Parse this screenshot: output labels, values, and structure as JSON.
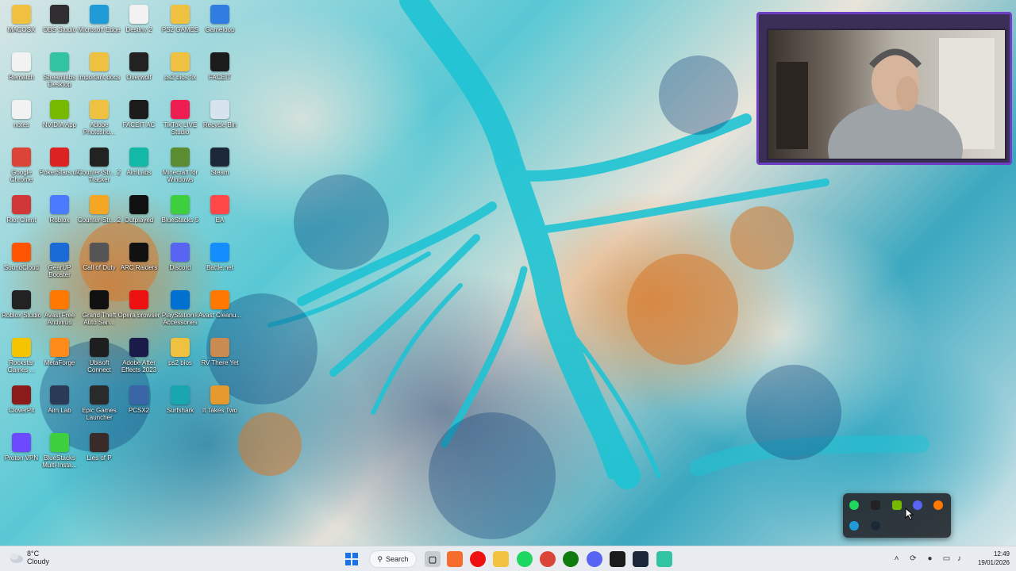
{
  "desktop_icons": [
    {
      "label": "MACOSX",
      "color": "#f0c040"
    },
    {
      "label": "OBS Studio",
      "color": "#302e31"
    },
    {
      "label": "Microsoft Edge",
      "color": "#1f9cd8"
    },
    {
      "label": "Destiny 2",
      "color": "#f2f2f2"
    },
    {
      "label": "PS2 GAMES",
      "color": "#f0c040"
    },
    {
      "label": "Gameloop",
      "color": "#2f7de1"
    },
    {
      "label": "Rematch",
      "color": "#f2f2f2"
    },
    {
      "label": "Streamlabs Desktop",
      "color": "#31c3a2"
    },
    {
      "label": "important docs",
      "color": "#f0c040"
    },
    {
      "label": "Overwolf",
      "color": "#222222"
    },
    {
      "label": "ps2 bios fix",
      "color": "#f0c040"
    },
    {
      "label": "FACEIT",
      "color": "#1b1b1b"
    },
    {
      "label": "notes",
      "color": "#f2f2f2"
    },
    {
      "label": "NVIDIA App",
      "color": "#76b900"
    },
    {
      "label": "Adobe Photosho...",
      "color": "#f0c040"
    },
    {
      "label": "FACEIT AC",
      "color": "#1b1b1b"
    },
    {
      "label": "TikTok LIVE Studio",
      "color": "#ee1d52"
    },
    {
      "label": "Recycle Bin",
      "color": "#d7e3ef"
    },
    {
      "label": "Google Chrome",
      "color": "#db4437"
    },
    {
      "label": "PokerStars.uk",
      "color": "#d22"
    },
    {
      "label": "Counter-Str... 2 Tracker",
      "color": "#222"
    },
    {
      "label": "AimLabs",
      "color": "#14b8a6"
    },
    {
      "label": "Minecraft for Windows",
      "color": "#5b8c32"
    },
    {
      "label": "Steam",
      "color": "#1b2838"
    },
    {
      "label": "Riot Client",
      "color": "#d13639"
    },
    {
      "label": "Roblox",
      "color": "#4a7bff"
    },
    {
      "label": "Counter-Str... 2",
      "color": "#f5a623"
    },
    {
      "label": "Outplayed",
      "color": "#111"
    },
    {
      "label": "BlueStacks 5",
      "color": "#3ecf3e"
    },
    {
      "label": "EA",
      "color": "#ff4747"
    },
    {
      "label": "SoundCloud",
      "color": "#ff5500"
    },
    {
      "label": "GearUP Booster",
      "color": "#1a6bd6"
    },
    {
      "label": "Call of Duty",
      "color": "#555"
    },
    {
      "label": "ARC Raiders",
      "color": "#111"
    },
    {
      "label": "Discord",
      "color": "#5865f2"
    },
    {
      "label": "Battle.net",
      "color": "#148eff"
    },
    {
      "label": "Roblox Studio",
      "color": "#222"
    },
    {
      "label": "Avast Free Antivirus",
      "color": "#ff7800"
    },
    {
      "label": "Grand Theft Auto San...",
      "color": "#111"
    },
    {
      "label": "Opera browser",
      "color": "#e11"
    },
    {
      "label": "PlayStation® Accessories",
      "color": "#0070d1"
    },
    {
      "label": "Avast Cleanu...",
      "color": "#ff7800"
    },
    {
      "label": "Rockstar Games ...",
      "color": "#f5c400"
    },
    {
      "label": "MetaForge",
      "color": "#ff8c1a"
    },
    {
      "label": "Ubisoft Connect",
      "color": "#1e1e1e"
    },
    {
      "label": "Adobe After Effects 2023",
      "color": "#1b1b4b"
    },
    {
      "label": "ps2 bios",
      "color": "#f0c040"
    },
    {
      "label": "RV There Yet",
      "color": "#c98b52"
    },
    {
      "label": "CloverPit",
      "color": "#8b1a1a"
    },
    {
      "label": "Aim Lab",
      "color": "#2b3b57"
    },
    {
      "label": "Epic Games Launcher",
      "color": "#2a2a2a"
    },
    {
      "label": "PCSX2",
      "color": "#3a66a8"
    },
    {
      "label": "Surfshark",
      "color": "#19a6b0"
    },
    {
      "label": "It Takes Two",
      "color": "#e59a2f"
    },
    {
      "label": "Proton VPN",
      "color": "#6d4aff"
    },
    {
      "label": "BlueStacks Multi-Insta...",
      "color": "#3ecf3e"
    },
    {
      "label": "Lies of P",
      "color": "#3a2a2a"
    }
  ],
  "webcam": {
    "label": "webcam-overlay"
  },
  "tray_popup": {
    "icons": [
      "spotify",
      "capture",
      "nvidia",
      "discord",
      "avast",
      "chrome-like",
      "steam"
    ]
  },
  "taskbar": {
    "weather": {
      "temp": "8°C",
      "condition": "Cloudy"
    },
    "search_label": "Search",
    "apps": [
      "start",
      "search",
      "task-view",
      "origin",
      "opera",
      "explorer",
      "spotify",
      "chrome",
      "xbox",
      "discord",
      "faceit",
      "steam",
      "streamlabs"
    ],
    "clock": {
      "time": "12:49",
      "date": "19/01/2026"
    }
  }
}
